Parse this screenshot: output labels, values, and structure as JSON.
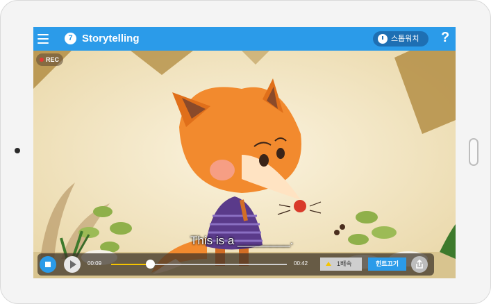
{
  "topbar": {
    "lesson_number": "7",
    "title": "Storytelling",
    "stopwatch_label": "스톱워치",
    "help_label": "?"
  },
  "video": {
    "rec_label": "REC",
    "subtitle": "This is a ________.",
    "current_time": "00:09",
    "total_time": "00:42",
    "progress": 0.22
  },
  "controls": {
    "speed_label": "1배속",
    "hint_label": "힌트끄기"
  },
  "colors": {
    "accent": "#2b9be9",
    "progress": "#f5c400"
  }
}
